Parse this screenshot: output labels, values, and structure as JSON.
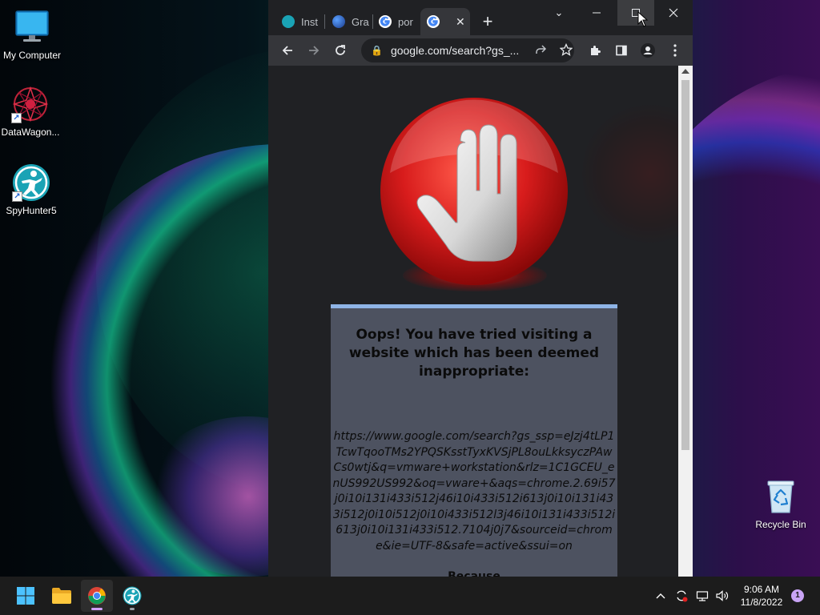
{
  "desktop": {
    "icons": [
      {
        "label": "My Computer"
      },
      {
        "label": "DataWagon..."
      },
      {
        "label": "SpyHunter5"
      },
      {
        "label": "Recycle Bin"
      }
    ]
  },
  "browser": {
    "tabs": [
      {
        "label": "Inst"
      },
      {
        "label": "Gra"
      },
      {
        "label": "por"
      },
      {
        "label": ""
      }
    ],
    "new_tab_label": "+",
    "address_bar": {
      "url": "google.com/search?gs_..."
    },
    "page": {
      "heading": "Oops! You have tried visiting a website which has been deemed inappropriate:",
      "blocked_url": "https://www.google.com/search?gs_ssp=eJzj4tLP1TcwTqooTMs2YPQSKsstTyxKVSjPL8ouLkksyczPAwCs0wtj&q=vmware+workstation&rlz=1C1GCEU_enUS992US992&oq=vware+&aqs=chrome.2.69i57j0i10i131i433i512j46i10i433i512i613j0i10i131i433i512j0i10i512j0i10i433i512l3j46i10i131i433i512i613j0i10i131i433i512.7104j0j7&sourceid=chrome&ie=UTF-8&safe=active&ssui=on",
      "because": "Because"
    }
  },
  "taskbar": {
    "time": "9:06 AM",
    "date": "11/8/2022",
    "notification_count": "1"
  },
  "colors": {
    "chrome_dark": "#202124",
    "chrome_toolbar": "#35363a",
    "panel_bg": "#4d5260",
    "panel_border": "#8fb4e6",
    "stop_red": "#d81c1c",
    "taskbar": "#1c1c1c"
  }
}
